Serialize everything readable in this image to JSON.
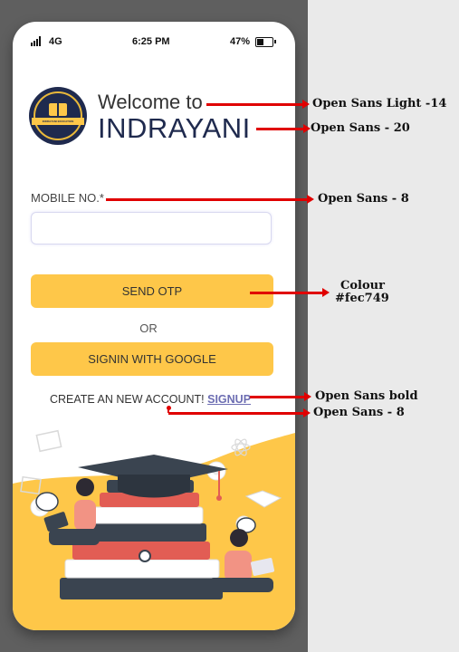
{
  "status_bar": {
    "network": "4G",
    "time": "6:25 PM",
    "battery": "47%"
  },
  "header": {
    "logo_text": "INDRAYANI EDUCATION",
    "welcome": "Welcome to",
    "brand": "INDRAYANI"
  },
  "form": {
    "mobile_label": "MOBILE NO.*",
    "mobile_value": "",
    "send_otp_label": "SEND OTP",
    "or_text": "OR",
    "google_label": "SIGNIN WITH GOOGLE",
    "create_text": "CREATE AN NEW ACCOUNT!",
    "signup_label": "SIGNUP"
  },
  "annotations": {
    "welcome_font": "Open Sans Light -14",
    "brand_font": "Open Sans - 20",
    "mobile_font": "Open Sans - 8",
    "colour_label": "Colour",
    "colour_value": "#fec749",
    "signup_font": "Open Sans bold",
    "create_font": "Open Sans - 8"
  },
  "colors": {
    "accent": "#fec749",
    "brand": "#1f2a4e",
    "signup_link": "#6c6db2",
    "annotation": "#e00000"
  },
  "icons": [
    "signal-icon",
    "battery-icon",
    "logo-icon",
    "graduation-cap-icon",
    "gear-icon",
    "chat-bubble-icon",
    "laptop-icon",
    "open-book-icon",
    "image-icon",
    "atom-icon"
  ]
}
